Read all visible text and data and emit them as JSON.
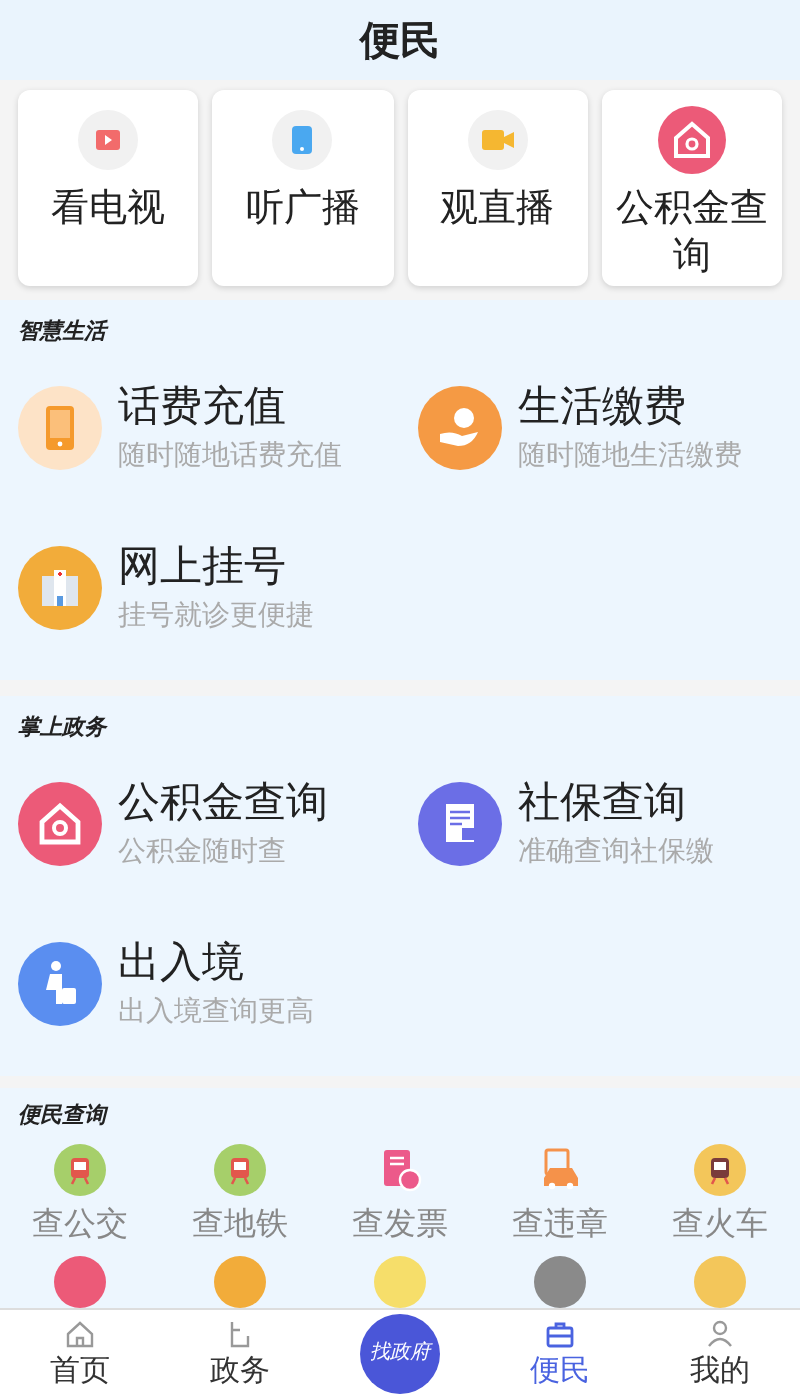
{
  "header": {
    "title": "便民"
  },
  "quick_cards": [
    {
      "label": "看电视",
      "color": "#f26b6b"
    },
    {
      "label": "听广播",
      "color": "#4aa8f0"
    },
    {
      "label": "观直播",
      "color": "#f5b731"
    },
    {
      "label": "公积金查询",
      "color": "#ec5a78"
    }
  ],
  "sections": [
    {
      "title": "智慧生活",
      "items": [
        {
          "title": "话费充值",
          "subtitle": "随时随地话费充值",
          "color": "#fde3c7"
        },
        {
          "title": "生活缴费",
          "subtitle": "随时随地生活缴费",
          "color": "#f59a44"
        },
        {
          "title": "网上挂号",
          "subtitle": "挂号就诊更便捷",
          "color": "#f2ac3a"
        }
      ]
    },
    {
      "title": "掌上政务",
      "items": [
        {
          "title": "公积金查询",
          "subtitle": "公积金随时查",
          "color": "#ec5a78"
        },
        {
          "title": "社保查询",
          "subtitle": "准确查询社保缴",
          "color": "#6b6ee6"
        },
        {
          "title": "出入境",
          "subtitle": "出入境查询更高",
          "color": "#5a8ef0"
        }
      ]
    }
  ],
  "query": {
    "title": "便民查询",
    "items": [
      {
        "label": "查公交",
        "color": "#a6cf6a"
      },
      {
        "label": "查地铁",
        "color": "#a6cf6a"
      },
      {
        "label": "查发票",
        "color": "#ec5a8a"
      },
      {
        "label": "查违章",
        "color": "#f5924a"
      },
      {
        "label": "查火车",
        "color": "#f3c65a"
      }
    ]
  },
  "bottom_nav": [
    {
      "label": "首页",
      "kind": "tab",
      "selected": false
    },
    {
      "label": "政务",
      "kind": "tab",
      "selected": false
    },
    {
      "label": "找政府",
      "kind": "center",
      "selected": false
    },
    {
      "label": "便民",
      "kind": "tab",
      "selected": true
    },
    {
      "label": "我的",
      "kind": "tab",
      "selected": false
    }
  ]
}
